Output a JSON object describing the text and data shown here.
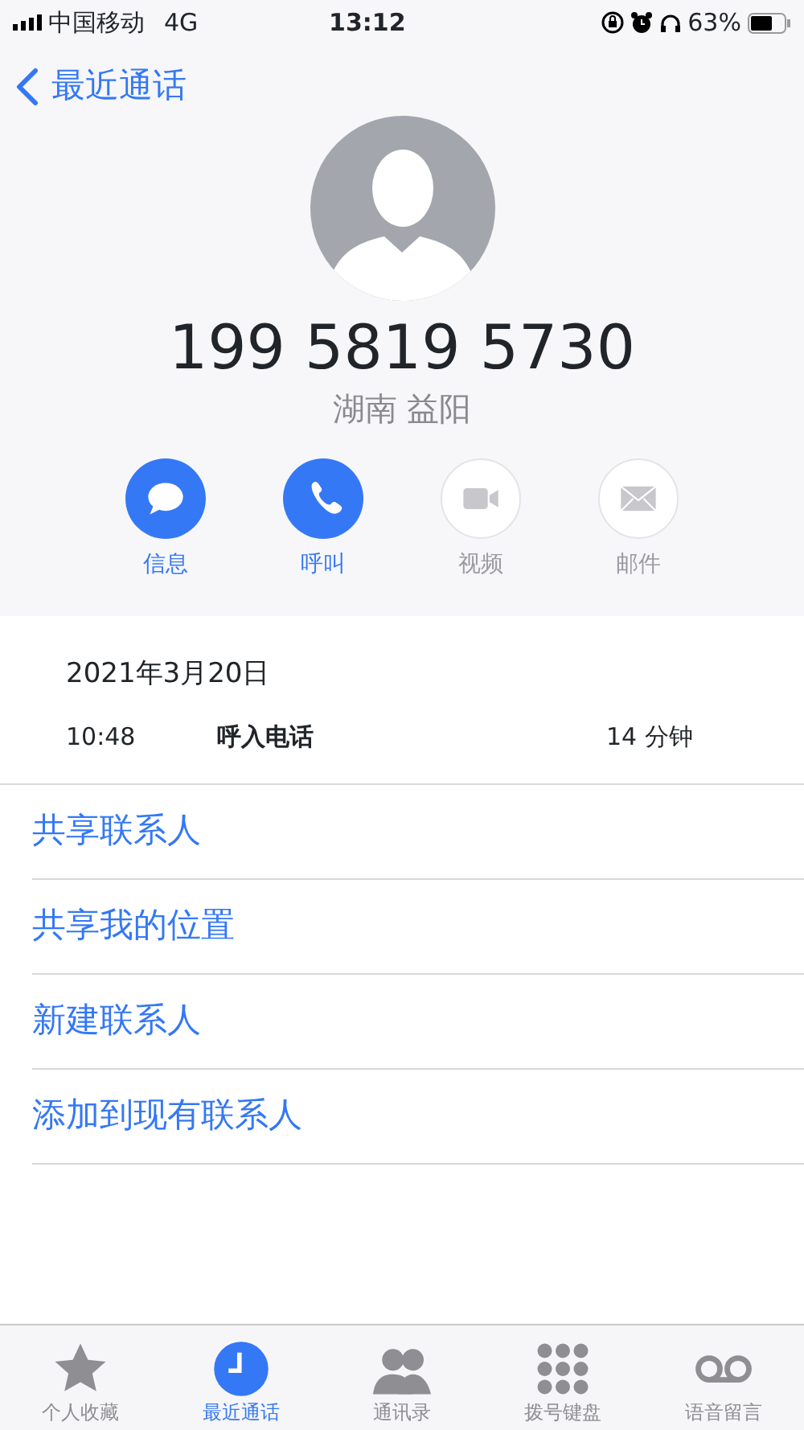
{
  "status_bar": {
    "carrier": "中国移动",
    "network": "4G",
    "time": "13:12",
    "battery": "63%"
  },
  "nav": {
    "back": "最近通话"
  },
  "contact": {
    "number": "199 5819 5730",
    "location": "湖南 益阳"
  },
  "actions": [
    {
      "kind": "message",
      "label": "信息",
      "disabled": false
    },
    {
      "kind": "call",
      "label": "呼叫",
      "disabled": false
    },
    {
      "kind": "video",
      "label": "视频",
      "disabled": true
    },
    {
      "kind": "mail",
      "label": "邮件",
      "disabled": true
    }
  ],
  "call_log": {
    "date": "2021年3月20日",
    "time": "10:48",
    "type": "呼入电话",
    "duration": "14 分钟"
  },
  "menu": [
    "共享联系人",
    "共享我的位置",
    "新建联系人",
    "添加到现有联系人"
  ],
  "tab_bar": [
    {
      "kind": "favorites",
      "label": "个人收藏",
      "selected": false
    },
    {
      "kind": "recents",
      "label": "最近通话",
      "selected": true
    },
    {
      "kind": "contacts",
      "label": "通讯录",
      "selected": false
    },
    {
      "kind": "keypad",
      "label": "拨号键盘",
      "selected": false
    },
    {
      "kind": "voicemail",
      "label": "语音留言",
      "selected": false
    }
  ]
}
